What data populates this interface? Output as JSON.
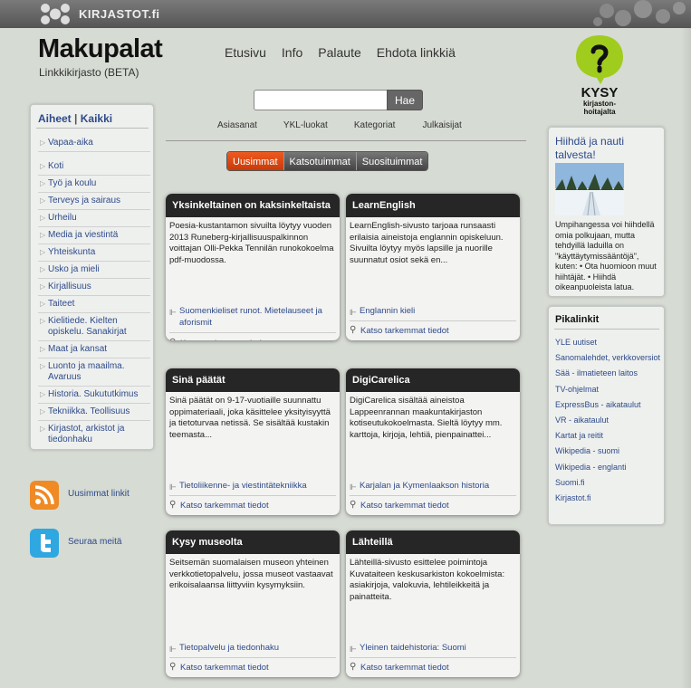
{
  "topbar": {
    "site_name": "KIRJASTOT.fi"
  },
  "header": {
    "title": "Makupalat",
    "subtitle": "Linkkikirjasto (BETA)"
  },
  "mainnav": [
    "Etusivu",
    "Info",
    "Palaute",
    "Ehdota linkkiä"
  ],
  "kysy": {
    "line1": "KYSY",
    "line2": "kirjaston-",
    "line3": "hoitajalta"
  },
  "search": {
    "value": "",
    "button": "Hae"
  },
  "subnav": [
    "Asiasanat",
    "YKL-luokat",
    "Kategoriat",
    "Julkaisijat"
  ],
  "tabs": [
    "Uusimmat",
    "Katsotuimmat",
    "Suosituimmat"
  ],
  "sidebar": {
    "head_a": "Aiheet",
    "sep": "|",
    "head_b": "Kaikki",
    "items": [
      "Vapaa-aika",
      "Koti",
      "Työ ja koulu",
      "Terveys ja sairaus",
      "Urheilu",
      "Media ja viestintä",
      "Yhteiskunta",
      "Usko ja mieli",
      "Kirjallisuus",
      "Taiteet",
      "Kielitiede. Kielten opiskelu. Sanakirjat",
      "Maat ja kansat",
      "Luonto ja maailma. Avaruus",
      "Historia. Sukututkimus",
      "Tekniikka. Teollisuus",
      "Kirjastot, arkistot ja tiedonhaku"
    ]
  },
  "feeds": {
    "rss": "Uusimmat linkit",
    "twitter": "Seuraa meitä"
  },
  "more_label": "Katso tarkemmat tiedot",
  "cards": [
    {
      "title": "Yksinkeltainen on kaksinkeltaista",
      "desc": "Poesia-kustantamon sivuilta löytyy vuoden 2013 Runeberg-kirjallisuuspalkinnon voittajan Olli-Pekka Tennilän runokokoelma pdf-muodossa.",
      "category": "Suomenkieliset runot. Mietelauseet ja aforismit"
    },
    {
      "title": "LearnEnglish",
      "desc": "LearnEnglish-sivusto tarjoaa runsaasti erilaisia aineistoja englannin opiskeluun. Sivuilta löytyy myös lapsille ja nuorille suunnatut osiot sekä en...",
      "category": "Englannin kieli"
    },
    {
      "title": "Sinä päätät",
      "desc": "Sinä päätät on 9-17-vuotiaille suunnattu oppimateriaali, joka käsittelee yksityisyyttä ja tietoturvaa netissä. Se sisältää kustakin teemasta...",
      "category": "Tietoliikenne- ja viestintätekniikka"
    },
    {
      "title": "DigiCarelica",
      "desc": "DigiCarelica sisältää aineistoa Lappeenrannan maakuntakirjaston kotiseutukokoelmasta. Sieltä löytyy mm. karttoja, kirjoja, lehtiä, pienpainattei...",
      "category": "Karjalan ja Kymenlaakson historia"
    },
    {
      "title": "Kysy museolta",
      "desc": "Seitsemän suomalaisen museon yhteinen verkkotietopalvelu, jossa museot vastaavat erikoisalaansa liittyviin kysymyksiin.",
      "category": "Tietopalvelu ja tiedonhaku"
    },
    {
      "title": "Lähteillä",
      "desc": "Lähteillä-sivusto esittelee poimintoja Kuvataiteen keskusarkiston kokoelmista: asiakirjoja, valokuvia, lehtileikkeitä ja painatteita.",
      "category": "Yleinen taidehistoria: Suomi"
    }
  ],
  "promo": {
    "title": "Hiihdä ja nauti talvesta!",
    "text": "Umpihangessa voi hiihdellä omia polkujaan, mutta tehdyillä laduilla on \"käyttäytymissääntöjä\", kuten: • Ota huomioon muut hiihtäjät. • Hiihdä oikeanpuoleista latua."
  },
  "quicklinks": {
    "title": "Pikalinkit",
    "items": [
      "YLE uutiset",
      "Sanomalehdet, verkkoversiot",
      "Sää - ilmatieteen laitos",
      "TV-ohjelmat",
      "ExpressBus - aikataulut",
      "VR - aikataulut",
      "Kartat ja reitit",
      "Wikipedia - suomi",
      "Wikipedia - englanti",
      "Suomi.fi",
      "Kirjastot.fi"
    ]
  },
  "colors": {
    "accent": "#e0501a",
    "link": "#2e4a8a",
    "card_head": "#262626"
  }
}
